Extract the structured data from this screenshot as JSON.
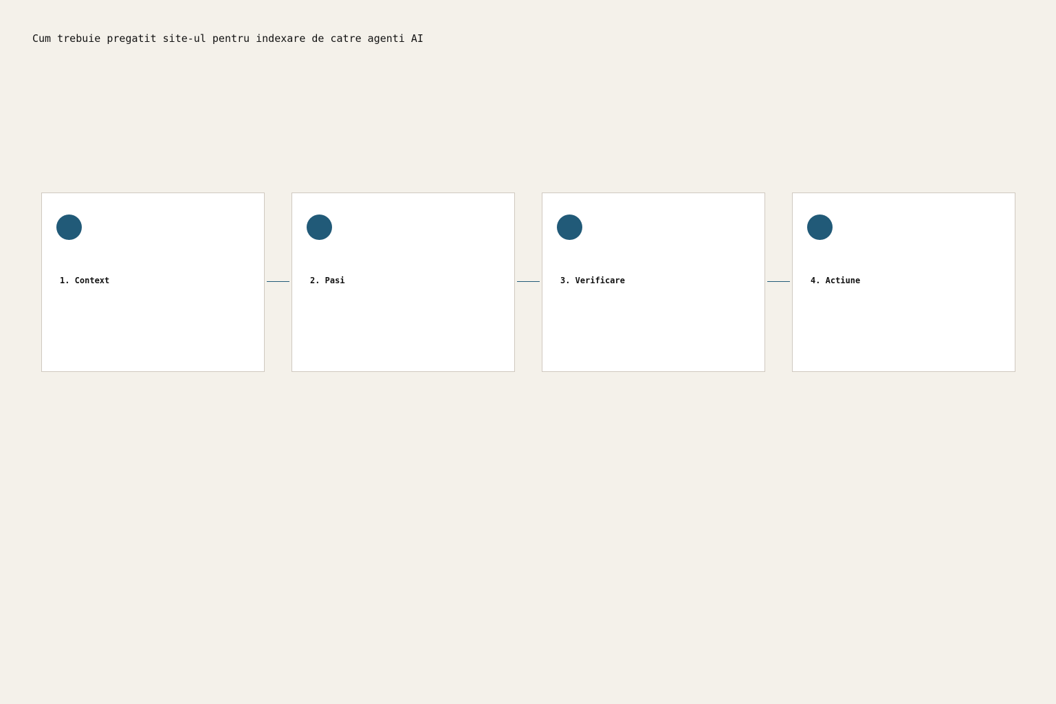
{
  "title": "Cum trebuie pregatit site-ul pentru indexare de catre agenti AI",
  "colors": {
    "background": "#f4f1ea",
    "card": "#ffffff",
    "card_border": "#cfc8bf",
    "accent": "#215a78",
    "text": "#111111"
  },
  "steps": [
    {
      "label": "1. Context"
    },
    {
      "label": "2. Pasi"
    },
    {
      "label": "3. Verificare"
    },
    {
      "label": "4. Actiune"
    }
  ]
}
